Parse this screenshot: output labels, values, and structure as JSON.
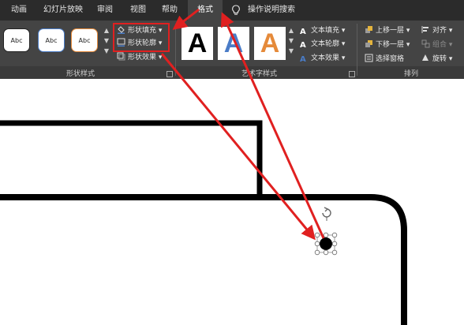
{
  "tabs": [
    {
      "label": "动画"
    },
    {
      "label": "幻灯片放映"
    },
    {
      "label": "审阅"
    },
    {
      "label": "视图"
    },
    {
      "label": "帮助"
    },
    {
      "label": "格式"
    }
  ],
  "tell_me": {
    "icon": "lightbulb-icon",
    "label": "操作说明搜索"
  },
  "shape_styles": {
    "swatch_label": "Abc",
    "fill": "形状填充",
    "outline": "形状轮廓",
    "effects": "形状效果",
    "group_label": "形状样式"
  },
  "wordart": {
    "letter": "A",
    "text_fill": "文本填充",
    "text_outline": "文本轮廓",
    "text_effects": "文本效果",
    "group_label": "艺术字样式"
  },
  "arrange": {
    "bring_forward": "上移一层",
    "send_backward": "下移一层",
    "selection_pane": "选择窗格",
    "align": "对齐",
    "group": "组合",
    "rotate": "旋转",
    "group_label": "排列"
  },
  "colors": {
    "annotation_red": "#e02020",
    "ribbon_bg": "#444444",
    "tabbar_bg": "#2b2b2b",
    "orange_accent": "#e58a3a",
    "blue_accent": "#4a7cc7"
  }
}
